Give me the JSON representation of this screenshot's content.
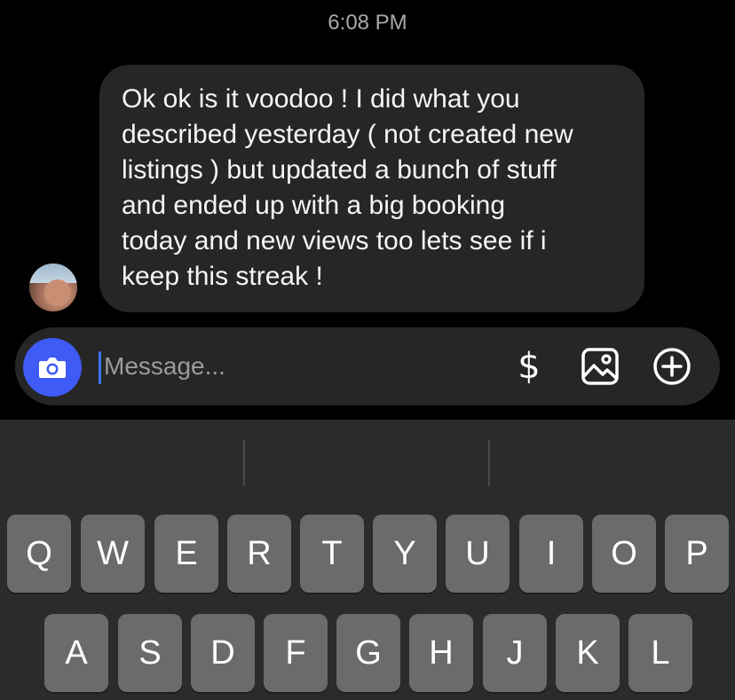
{
  "chat": {
    "timestamp": "6:08 PM",
    "message_text": "Ok ok is it voodoo ! I did what you\ndescribed yesterday ( not created new\nlistings ) but updated a bunch of stuff\nand ended up with a big booking\ntoday and new views too lets see if i\nkeep this streak !"
  },
  "composer": {
    "placeholder": "Message...",
    "value": "",
    "icons": [
      "camera-icon",
      "dollar-icon",
      "image-icon",
      "plus-circle-icon"
    ],
    "dollar_label": "$",
    "accent_color": "#3f5bf6"
  },
  "keyboard": {
    "row1": [
      "Q",
      "W",
      "E",
      "R",
      "T",
      "Y",
      "U",
      "I",
      "O",
      "P"
    ],
    "row2": [
      "A",
      "S",
      "D",
      "F",
      "G",
      "H",
      "J",
      "K",
      "L"
    ]
  }
}
